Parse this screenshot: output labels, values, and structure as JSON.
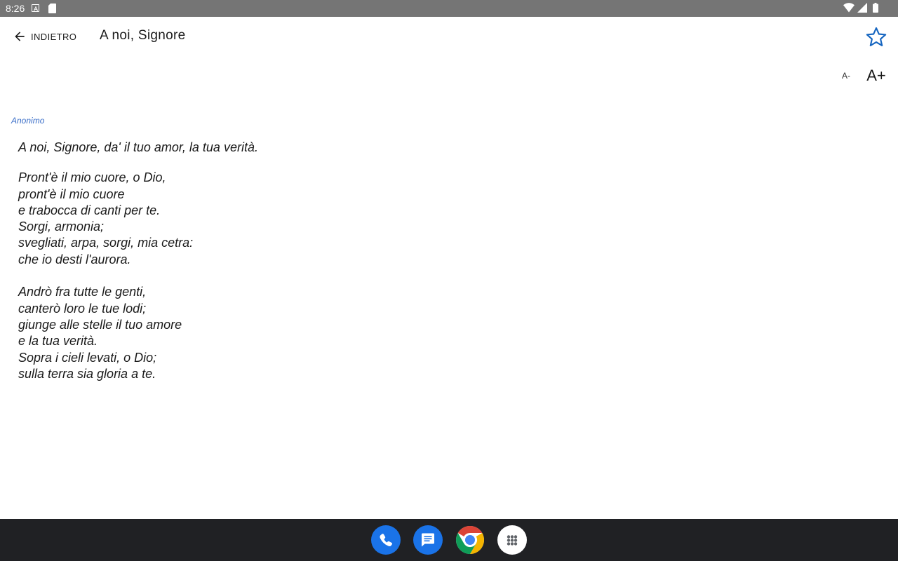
{
  "status_bar": {
    "time": "8:26"
  },
  "app_bar": {
    "back_label": "INDIETRO",
    "title": "A noi, Signore"
  },
  "font_controls": {
    "smaller_label": "A-",
    "larger_label": "A+"
  },
  "song": {
    "author": "Anonimo",
    "refrain": "A noi, Signore, da' il tuo amor, la tua verità.",
    "stanza_1": [
      "Pront'è il mio cuore, o Dio,",
      "pront'è il mio cuore",
      "e trabocca di canti per te.",
      "Sorgi, armonia;",
      "svegliati, arpa, sorgi, mia cetra:",
      "che io desti l'aurora."
    ],
    "stanza_2": [
      "Andrò fra tutte le genti,",
      "canterò loro le tue lodi;",
      "giunge alle stelle il tuo amore",
      "e la tua verità.",
      "Sopra i cieli levati, o Dio;",
      "sulla terra sia gloria a te."
    ]
  },
  "colors": {
    "status_bar": "#757575",
    "accent": "#1565c0",
    "author": "#3a6ec8",
    "dock": "#202124"
  },
  "icons": {
    "back": "arrow-left-icon",
    "favorite": "star-outline-icon",
    "dock": [
      "phone-icon",
      "messages-icon",
      "chrome-icon",
      "app-drawer-icon"
    ]
  }
}
